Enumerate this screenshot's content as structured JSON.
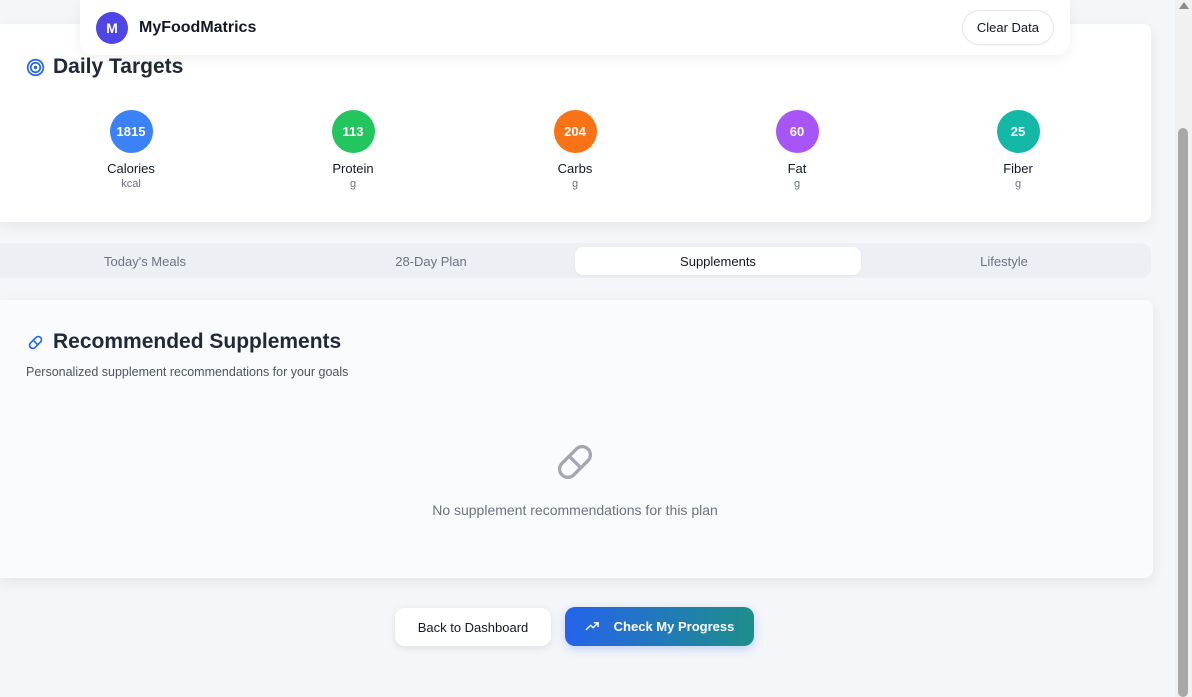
{
  "header": {
    "logo_letter": "M",
    "app_name": "MyFoodMatrics",
    "clear_button": "Clear Data"
  },
  "daily_targets": {
    "title": "Daily Targets",
    "items": [
      {
        "value": "1815",
        "label": "Calories",
        "unit": "kcal",
        "color": "#3b82f6"
      },
      {
        "value": "113",
        "label": "Protein",
        "unit": "g",
        "color": "#22c55e"
      },
      {
        "value": "204",
        "label": "Carbs",
        "unit": "g",
        "color": "#f97316"
      },
      {
        "value": "60",
        "label": "Fat",
        "unit": "g",
        "color": "#a855f7"
      },
      {
        "value": "25",
        "label": "Fiber",
        "unit": "g",
        "color": "#14b8a6"
      }
    ]
  },
  "tabs": [
    {
      "label": "Today's Meals",
      "active": false
    },
    {
      "label": "28-Day Plan",
      "active": false
    },
    {
      "label": "Supplements",
      "active": true
    },
    {
      "label": "Lifestyle",
      "active": false
    }
  ],
  "supplements": {
    "title": "Recommended Supplements",
    "subtitle": "Personalized supplement recommendations for your goals",
    "empty_message": "No supplement recommendations for this plan"
  },
  "actions": {
    "back_button": "Back to Dashboard",
    "progress_button": "Check My Progress"
  },
  "colors": {
    "accent": "#4f46e5",
    "primary_gradient_start": "#2563eb",
    "primary_gradient_end": "#1d8f8a"
  }
}
